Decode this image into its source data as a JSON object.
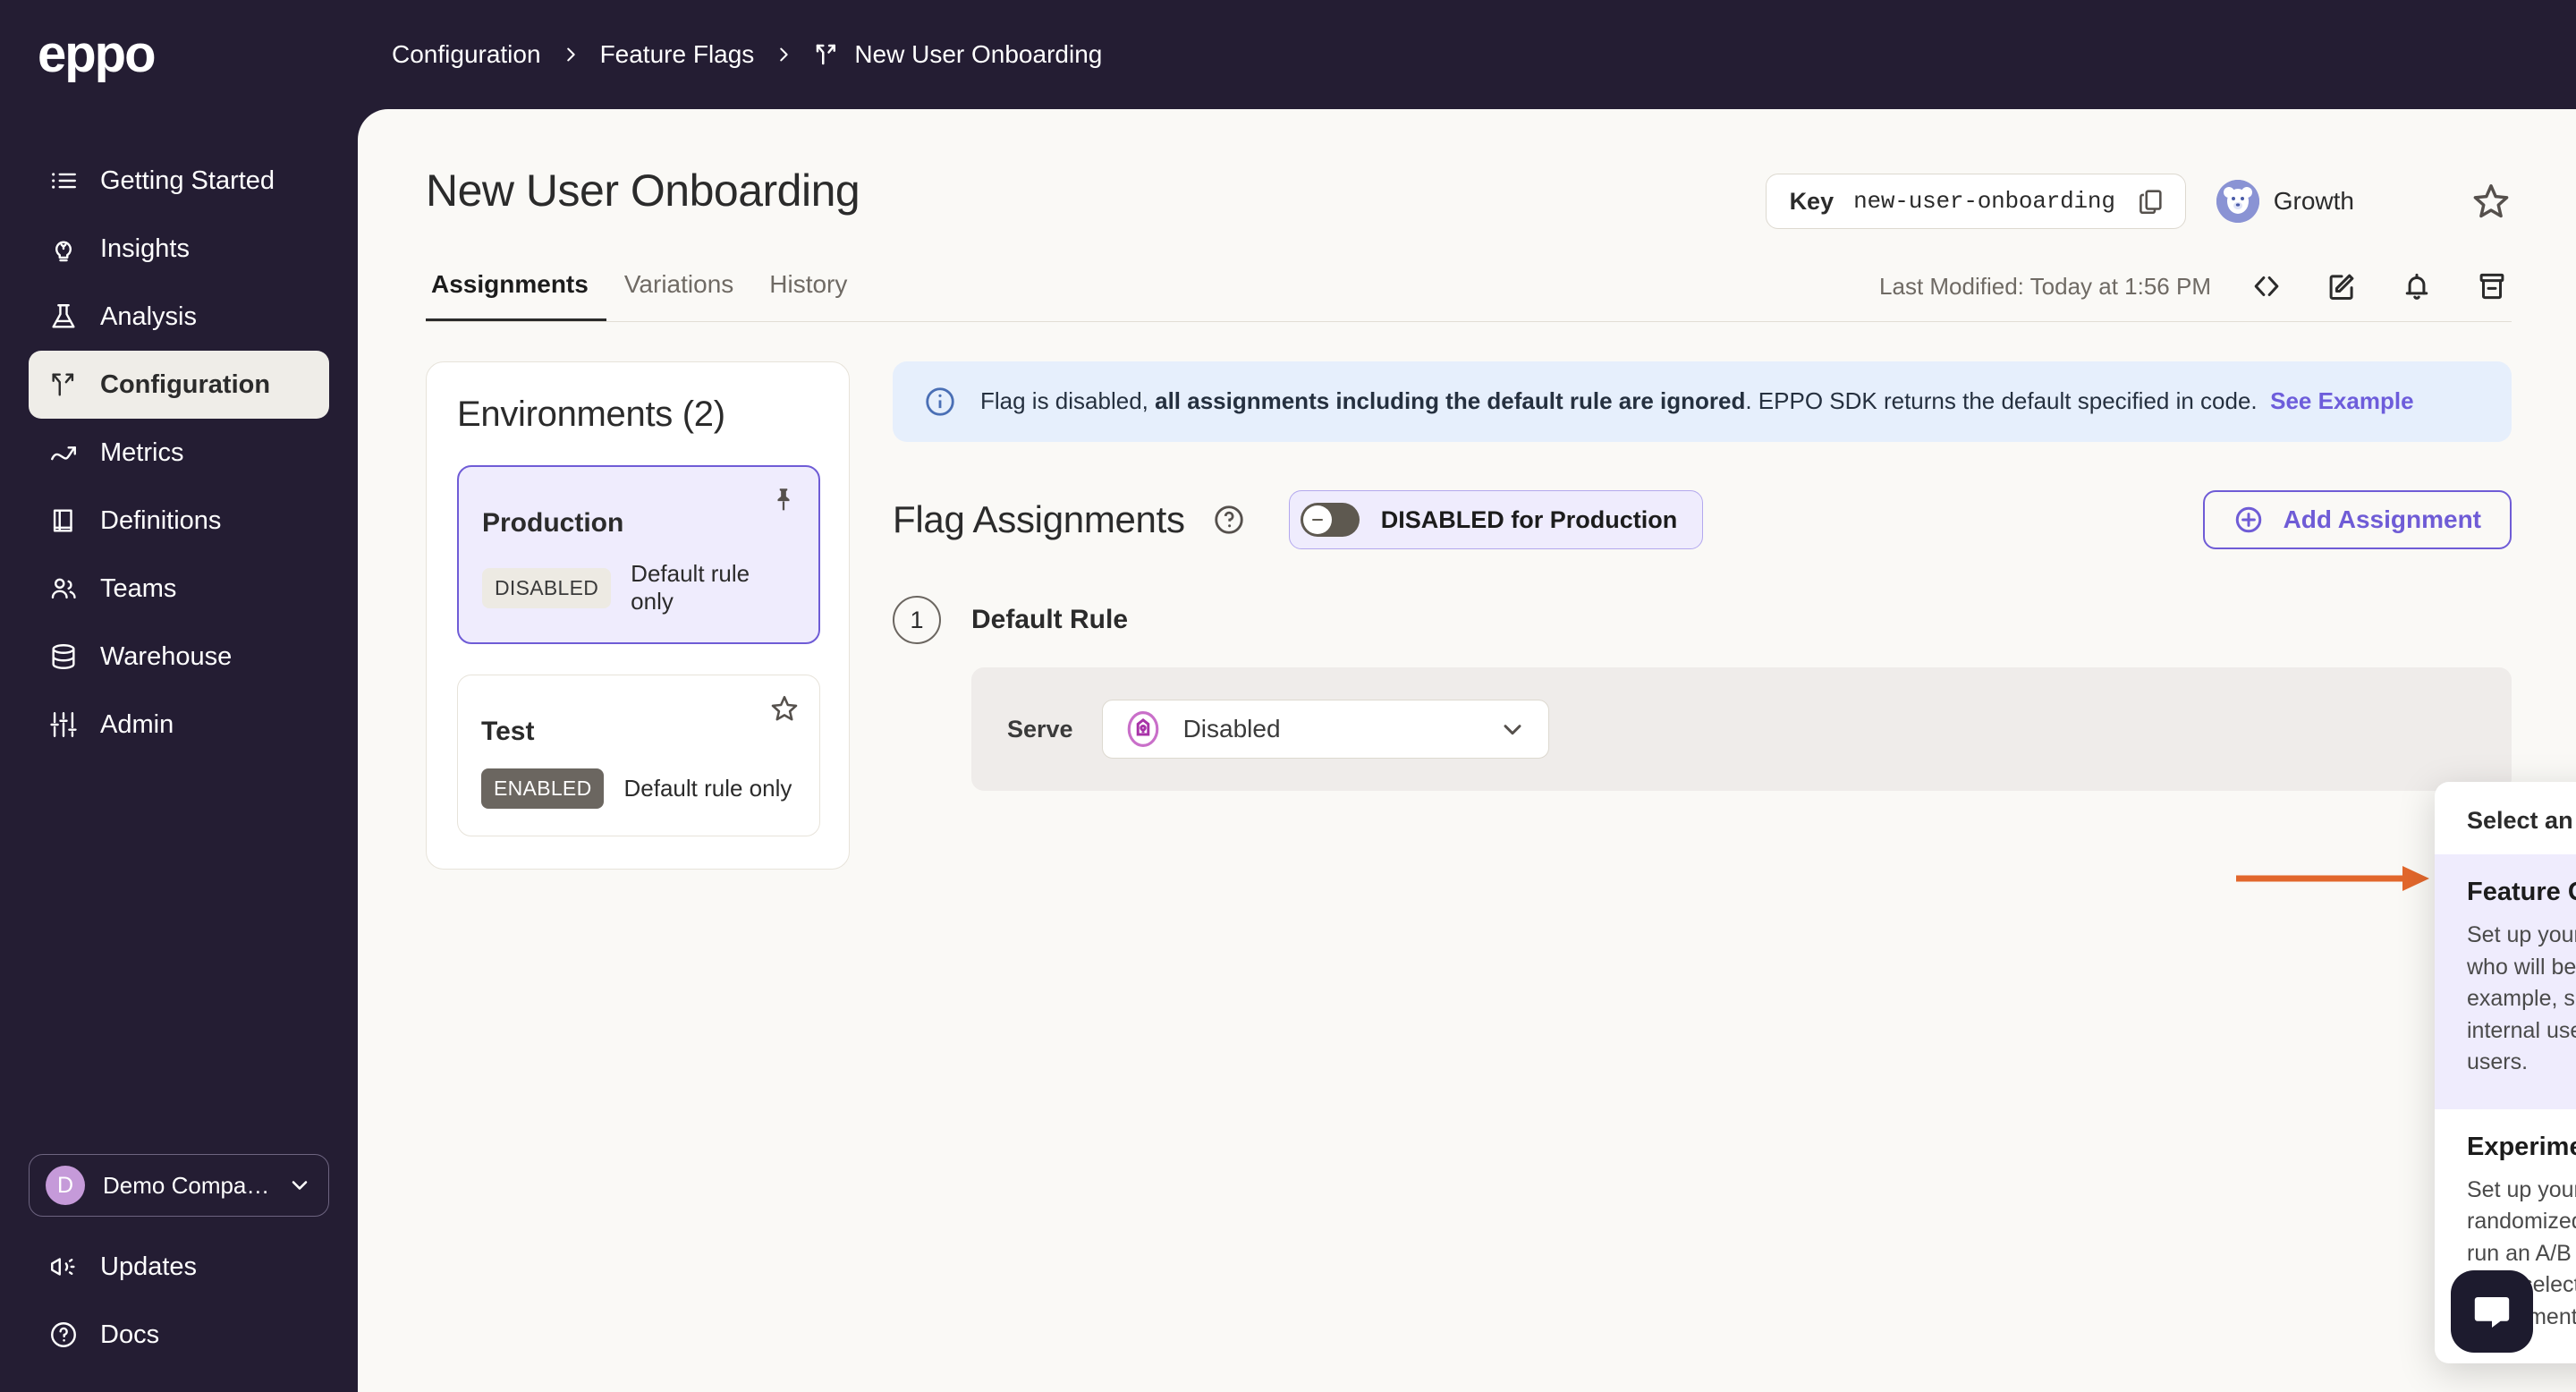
{
  "brand": {
    "logo_text": "eppo",
    "accent": "#6f5cd6",
    "sidebar_bg": "#241d33",
    "content_bg": "#faf9f6"
  },
  "sidebar": {
    "items": [
      {
        "label": "Getting Started",
        "icon": "list-icon",
        "active": false
      },
      {
        "label": "Insights",
        "icon": "lightbulb-icon",
        "active": false
      },
      {
        "label": "Analysis",
        "icon": "flask-icon",
        "active": false
      },
      {
        "label": "Configuration",
        "icon": "flag-branch-icon",
        "active": true
      },
      {
        "label": "Metrics",
        "icon": "trend-icon",
        "active": false
      },
      {
        "label": "Definitions",
        "icon": "book-icon",
        "active": false
      },
      {
        "label": "Teams",
        "icon": "people-icon",
        "active": false
      },
      {
        "label": "Warehouse",
        "icon": "database-icon",
        "active": false
      },
      {
        "label": "Admin",
        "icon": "sliders-icon",
        "active": false
      }
    ],
    "org": {
      "initial": "D",
      "name": "Demo Compa…"
    },
    "footer_items": [
      {
        "label": "Updates",
        "icon": "megaphone-icon"
      },
      {
        "label": "Docs",
        "icon": "question-circle-icon"
      }
    ]
  },
  "topbar": {
    "collapse_icon": "collapse-sidebar-icon",
    "breadcrumb": [
      {
        "label": "Configuration",
        "icon": null
      },
      {
        "label": "Feature Flags",
        "icon": null
      },
      {
        "label": "New User Onboarding",
        "icon": "flag-branch-icon"
      }
    ]
  },
  "header": {
    "title": "New User Onboarding",
    "key_label": "Key",
    "key_value": "new-user-onboarding",
    "copy_icon": "copy-icon",
    "team": {
      "name": "Growth",
      "avatar_icon": "bear-avatar-icon",
      "avatar_color": "#8a93d4"
    },
    "star_icon": "star-outline-icon"
  },
  "tabs": [
    {
      "label": "Assignments",
      "active": true
    },
    {
      "label": "Variations",
      "active": false
    },
    {
      "label": "History",
      "active": false
    }
  ],
  "tabs_meta": {
    "last_modified": "Last Modified: Today at 1:56 PM",
    "icons": [
      {
        "name": "code-brackets-icon"
      },
      {
        "name": "edit-pencil-icon"
      },
      {
        "name": "bell-icon"
      },
      {
        "name": "archive-icon"
      }
    ]
  },
  "environments": {
    "title": "Environments (2)",
    "cards": [
      {
        "name": "Production",
        "badge": "DISABLED",
        "badge_state": "disabled",
        "rule": "Default rule only",
        "selected": true,
        "corner_icon": "pin-icon"
      },
      {
        "name": "Test",
        "badge": "ENABLED",
        "badge_state": "enabled",
        "rule": "Default rule only",
        "selected": false,
        "corner_icon": "star-outline-icon"
      }
    ]
  },
  "banner": {
    "icon": "info-circle-icon",
    "text_before": "Flag is disabled, ",
    "text_bold": "all assignments including the default rule are ignored",
    "text_after": ". EPPO SDK returns the default specified in code.  ",
    "link": "See Example",
    "bg": "#e6effc",
    "link_color": "#6d5ddb"
  },
  "assignments": {
    "title": "Flag Assignments",
    "help_icon": "question-circle-icon",
    "toggle": {
      "label": "DISABLED for Production",
      "state": "off",
      "icon": "minus-circle-icon"
    },
    "add_button": {
      "label": "Add Assignment",
      "icon": "plus-circle-icon"
    },
    "rule": {
      "number": "1",
      "name": "Default Rule",
      "serve_label": "Serve",
      "serve_value": "Disabled",
      "serve_variant_icon": "variant-shield-icon",
      "caret_icon": "chevron-down-icon"
    }
  },
  "dropdown": {
    "header": "Select an Assignment type",
    "options": [
      {
        "title": "Feature Gate",
        "desc": "Set up your assignment to define who will be served what variant. For example, serve a specific variant to internal users or a set of “beta” users.",
        "highlighted": true
      },
      {
        "title": "Experiment",
        "desc": "Set up your assignment with a randomized traffic split needed to run an A/B or multi-variant test. You must select this type to run an experiment.",
        "highlighted": false
      }
    ]
  },
  "annotation": {
    "arrow_color": "#e2672c",
    "points_to": "Feature Gate"
  },
  "intercom": {
    "icon": "chat-bubble-icon",
    "bg": "#1d1b2e"
  }
}
